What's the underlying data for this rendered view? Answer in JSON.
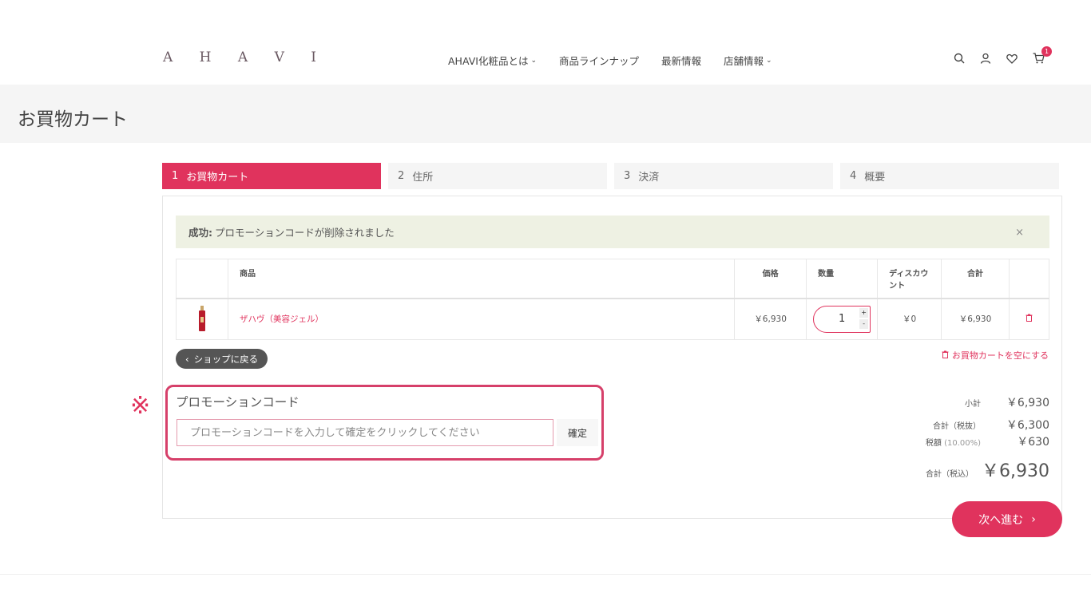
{
  "header": {
    "logo": "A H A V I",
    "nav": [
      {
        "label": "AHAVI化粧品とは",
        "has_dropdown": true
      },
      {
        "label": "商品ラインナップ",
        "has_dropdown": false
      },
      {
        "label": "最新情報",
        "has_dropdown": false
      },
      {
        "label": "店舗情報",
        "has_dropdown": true
      }
    ],
    "icons": [
      "search-icon",
      "user-icon",
      "heart-icon",
      "cart-icon"
    ],
    "cart_count": "1"
  },
  "page": {
    "title": "お買物カート"
  },
  "steps": [
    {
      "num": "1",
      "label": "お買物カート",
      "active": true
    },
    {
      "num": "2",
      "label": "住所",
      "active": false
    },
    {
      "num": "3",
      "label": "決済",
      "active": false
    },
    {
      "num": "4",
      "label": "概要",
      "active": false
    }
  ],
  "alert": {
    "strong": "成功:",
    "message": "プロモーションコードが削除されました",
    "close": "×"
  },
  "table": {
    "headers": {
      "product": "商品",
      "price": "価格",
      "qty": "数量",
      "discount": "ディスカウント",
      "total": "合計"
    },
    "rows": [
      {
        "name": "ザハヴ（美容ジェル）",
        "price": "￥6,930",
        "qty": "1",
        "discount": "￥0",
        "total": "￥6,930"
      }
    ]
  },
  "actions": {
    "back": "ショップに戻る",
    "empty_cart": "お買物カートを空にする"
  },
  "promo": {
    "marker": "※",
    "title": "プロモーションコード",
    "placeholder": "プロモーションコードを入力して確定をクリックしてください",
    "submit": "確定"
  },
  "totals": {
    "subtotal_label": "小計",
    "subtotal": "￥6,930",
    "excl_label": "合計（税抜）",
    "excl": "￥6,300",
    "tax_label": "税額",
    "tax_rate": "(10.00%)",
    "tax": "￥630",
    "incl_label": "合計（税込）",
    "incl": "￥6,930"
  },
  "next": {
    "label": "次へ進む"
  },
  "colors": {
    "accent": "#e0335d",
    "alert_bg": "#eef1e3"
  }
}
